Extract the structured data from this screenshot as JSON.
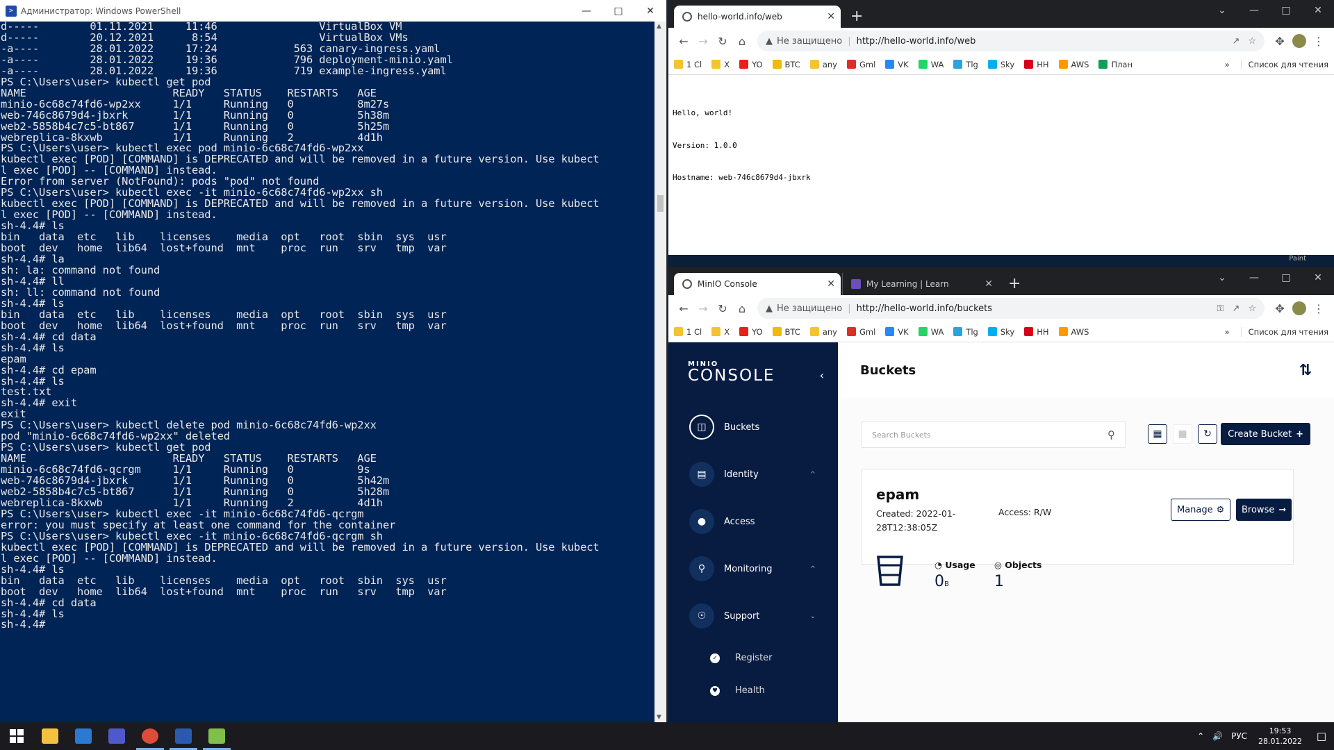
{
  "powershell": {
    "title": "Администратор: Windows PowerShell",
    "lines": [
      "d-----        01.11.2021     11:46                VirtualBox VM",
      "d-----        20.12.2021      8:54                VirtualBox VMs",
      "-a----        28.01.2022     17:24            563 canary-ingress.yaml",
      "-a----        28.01.2022     19:36            796 deployment-minio.yaml",
      "-a----        28.01.2022     19:36            719 example-ingress.yaml",
      "",
      "",
      "PS C:\\Users\\user> kubectl get pod",
      "NAME                       READY   STATUS    RESTARTS   AGE",
      "minio-6c68c74fd6-wp2xx     1/1     Running   0          8m27s",
      "web-746c8679d4-jbxrk       1/1     Running   0          5h38m",
      "web2-5858b4c7c5-bt867      1/1     Running   0          5h25m",
      "webreplica-8kxwb           1/1     Running   2          4d1h",
      "PS C:\\Users\\user> kubectl exec pod minio-6c68c74fd6-wp2xx",
      "kubectl exec [POD] [COMMAND] is DEPRECATED and will be removed in a future version. Use kubect",
      "l exec [POD] -- [COMMAND] instead.",
      "Error from server (NotFound): pods \"pod\" not found",
      "PS C:\\Users\\user> kubectl exec -it minio-6c68c74fd6-wp2xx sh",
      "kubectl exec [POD] [COMMAND] is DEPRECATED and will be removed in a future version. Use kubect",
      "l exec [POD] -- [COMMAND] instead.",
      "sh-4.4# ls",
      "bin   data  etc   lib    licenses    media  opt   root  sbin  sys  usr",
      "boot  dev   home  lib64  lost+found  mnt    proc  run   srv   tmp  var",
      "sh-4.4# la",
      "sh: la: command not found",
      "sh-4.4# ll",
      "sh: ll: command not found",
      "sh-4.4# ls",
      "bin   data  etc   lib    licenses    media  opt   root  sbin  sys  usr",
      "boot  dev   home  lib64  lost+found  mnt    proc  run   srv   tmp  var",
      "sh-4.4# cd data",
      "sh-4.4# ls",
      "epam",
      "sh-4.4# cd epam",
      "sh-4.4# ls",
      "test.txt",
      "sh-4.4# exit",
      "exit",
      "PS C:\\Users\\user> kubectl delete pod minio-6c68c74fd6-wp2xx",
      "pod \"minio-6c68c74fd6-wp2xx\" deleted",
      "PS C:\\Users\\user> kubectl get pod",
      "NAME                       READY   STATUS    RESTARTS   AGE",
      "minio-6c68c74fd6-qcrgm     1/1     Running   0          9s",
      "web-746c8679d4-jbxrk       1/1     Running   0          5h42m",
      "web2-5858b4c7c5-bt867      1/1     Running   0          5h28m",
      "webreplica-8kxwb           1/1     Running   2          4d1h",
      "PS C:\\Users\\user> kubectl exec -it minio-6c68c74fd6-qcrgm",
      "error: you must specify at least one command for the container",
      "PS C:\\Users\\user> kubectl exec -it minio-6c68c74fd6-qcrgm sh",
      "kubectl exec [POD] [COMMAND] is DEPRECATED and will be removed in a future version. Use kubect",
      "l exec [POD] -- [COMMAND] instead.",
      "sh-4.4# ls",
      "bin   data  etc   lib    licenses    media  opt   root  sbin  sys  usr",
      "boot  dev   home  lib64  lost+found  mnt    proc  run   srv   tmp  var",
      "sh-4.4# cd data",
      "sh-4.4# ls",
      "sh-4.4#"
    ]
  },
  "browser_top": {
    "tab_title": "hello-world.info/web",
    "security_label": "Не защищено",
    "url": "http://hello-world.info/web",
    "page_lines": [
      "Hello, world!",
      "Version: 1.0.0",
      "Hostname: web-746c8679d4-jbxrk"
    ]
  },
  "bookmarks": {
    "items": [
      {
        "label": "1 Cl",
        "color": "#f4c430"
      },
      {
        "label": "X",
        "color": "#f4c430"
      },
      {
        "label": "YO",
        "color": "#e62117"
      },
      {
        "label": "BTC",
        "color": "#f0b90b"
      },
      {
        "label": "any",
        "color": "#f4c430"
      },
      {
        "label": "Gml",
        "color": "#d93025"
      },
      {
        "label": "VK",
        "color": "#2787f5"
      },
      {
        "label": "WA",
        "color": "#25d366"
      },
      {
        "label": "Tlg",
        "color": "#2aa3df"
      },
      {
        "label": "Sky",
        "color": "#00aff0"
      },
      {
        "label": "HH",
        "color": "#d6001c"
      },
      {
        "label": "AWS",
        "color": "#ff9900"
      },
      {
        "label": "План",
        "color": "#0f9d58"
      }
    ],
    "more": "»",
    "reading_list": "Список для чтения"
  },
  "gap_label": "Paint",
  "browser_minio": {
    "tabs": [
      {
        "title": "MinIO Console"
      },
      {
        "title": "My Learning | Learn"
      }
    ],
    "security_label": "Не защищено",
    "url": "http://hello-world.info/buckets",
    "logo_small": "MINIO",
    "logo_big": "CONSOLE",
    "menu": [
      {
        "label": "Buckets"
      },
      {
        "label": "Identity"
      },
      {
        "label": "Access"
      },
      {
        "label": "Monitoring"
      },
      {
        "label": "Support"
      }
    ],
    "submenu": [
      {
        "label": "Register"
      },
      {
        "label": "Health"
      }
    ],
    "page_title": "Buckets",
    "search_placeholder": "Search Buckets",
    "create_bucket": "Create Bucket",
    "bucket": {
      "name": "epam",
      "created_label": "Created: 2022-01-28T12:38:05Z",
      "access_label": "Access: R/W",
      "manage_label": "Manage",
      "browse_label": "Browse",
      "usage_label": "Usage",
      "usage_value": "0",
      "usage_unit": "B",
      "objects_label": "Objects",
      "objects_value": "1"
    }
  },
  "taskbar": {
    "lang": "РУС",
    "time": "19:53",
    "date": "28.01.2022"
  }
}
